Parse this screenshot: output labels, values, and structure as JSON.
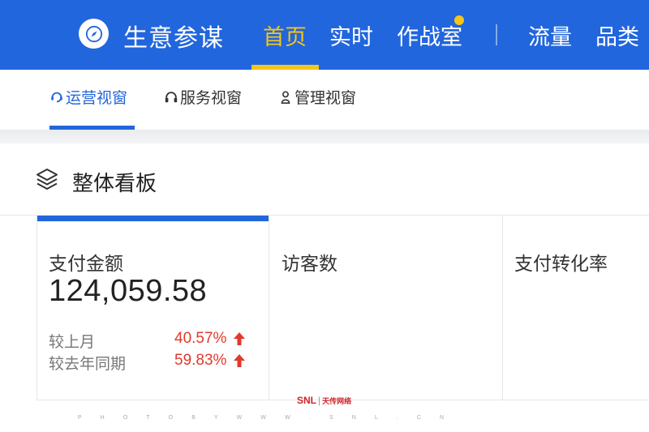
{
  "header": {
    "brand": "生意参谋",
    "nav": [
      {
        "label": "首页",
        "active": true
      },
      {
        "label": "实时"
      },
      {
        "label": "作战室",
        "has_dot": true
      },
      {
        "label": "流量"
      },
      {
        "label": "品类"
      }
    ]
  },
  "subtabs": [
    {
      "label": "运营视窗",
      "icon": "headset-refresh-icon",
      "active": true
    },
    {
      "label": "服务视窗",
      "icon": "headphones-icon"
    },
    {
      "label": "管理视窗",
      "icon": "person-icon"
    }
  ],
  "panel": {
    "title": "整体看板",
    "icon": "layers-icon"
  },
  "cards": [
    {
      "label": "支付金额",
      "value": "124,059.58",
      "selected": true,
      "comparisons": [
        {
          "label": "较上月",
          "value": "40.57%",
          "trend": "up"
        },
        {
          "label": "较去年同期",
          "value": "59.83%",
          "trend": "up"
        }
      ]
    },
    {
      "label": "访客数"
    },
    {
      "label": "支付转化率"
    }
  ],
  "watermark": {
    "logo_text": "SNL",
    "logo_cn": "天传网络",
    "caption": "P H O T O   B Y   W W W . S N L . C N"
  },
  "colors": {
    "primary": "#2266dd",
    "nav_active": "#f5c518",
    "trend_up": "#e03a2e"
  }
}
